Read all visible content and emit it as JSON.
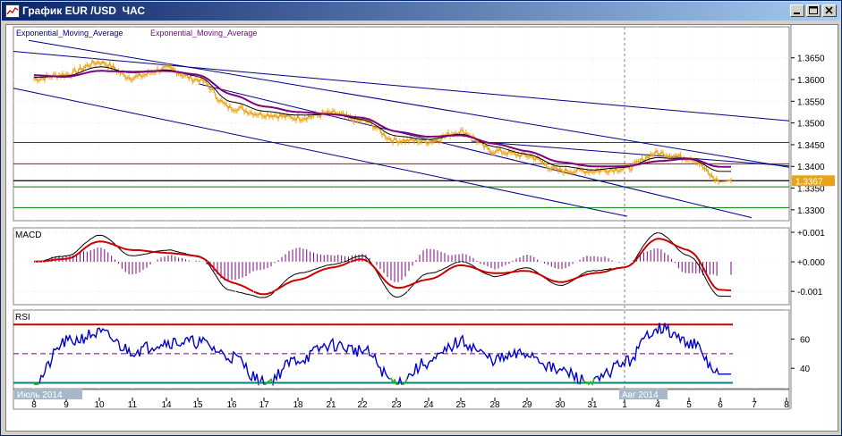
{
  "window": {
    "title": "График EUR /USD  ЧАС",
    "minimize_icon": "minimize-icon",
    "maximize_icon": "maximize-icon",
    "close_icon": "close-icon"
  },
  "colors": {
    "price": "#e8a317",
    "ema_fast": "#000000",
    "ema_slow": "#7f007f",
    "trendline": "#00008b",
    "resistance": "#cc0000",
    "support": "#008000",
    "current_line": "#000000",
    "current_tag": "#e8a317",
    "macd": "#000000",
    "signal": "#cc0000",
    "histogram": "#7f007f",
    "rsi": "#0000cc",
    "rsi_extreme": "#22bb22",
    "rsi_upper_band": "#cc0000",
    "rsi_mid_band": "#7f007f",
    "rsi_lower_band": "#008080"
  },
  "chart_data": [
    {
      "type": "line",
      "panel": "price",
      "legend_text": [
        "Exponential_Moving_Average",
        "Exponential_Moving_Average"
      ],
      "y_ticks": [
        "1.3650",
        "1.3600",
        "1.3550",
        "1.3500",
        "1.3450",
        "1.3400",
        "1.3350",
        "1.3300"
      ],
      "ylim": [
        1.3275,
        1.3705
      ],
      "x": [
        "8",
        "9",
        "10",
        "11",
        "14",
        "15",
        "16",
        "17",
        "18",
        "21",
        "22",
        "23",
        "24",
        "25",
        "28",
        "29",
        "30",
        "31",
        "1",
        "4",
        "5",
        "6"
      ],
      "series": [
        {
          "role": "price",
          "values": [
            1.3602,
            1.3612,
            1.364,
            1.3605,
            1.3625,
            1.36,
            1.3535,
            1.352,
            1.3512,
            1.3522,
            1.3505,
            1.346,
            1.3458,
            1.348,
            1.3435,
            1.3425,
            1.339,
            1.339,
            1.3395,
            1.343,
            1.342,
            1.3367
          ]
        },
        {
          "role": "ema_fast",
          "values": [
            1.3605,
            1.3608,
            1.363,
            1.3615,
            1.3622,
            1.3608,
            1.3548,
            1.3528,
            1.3518,
            1.352,
            1.3508,
            1.347,
            1.3462,
            1.3475,
            1.3445,
            1.3428,
            1.34,
            1.3392,
            1.3398,
            1.342,
            1.3418,
            1.3388
          ]
        },
        {
          "role": "ema_slow",
          "values": [
            1.361,
            1.3606,
            1.362,
            1.3618,
            1.362,
            1.3612,
            1.3565,
            1.3538,
            1.3525,
            1.352,
            1.3512,
            1.348,
            1.3468,
            1.3472,
            1.3452,
            1.3435,
            1.341,
            1.34,
            1.34,
            1.3412,
            1.3418,
            1.3398
          ]
        }
      ],
      "horizontal_levels": [
        {
          "role": "resistance",
          "value": 1.3455
        },
        {
          "role": "resistance",
          "value": 1.3406
        },
        {
          "role": "current",
          "value": 1.3367
        },
        {
          "role": "support",
          "value": 1.3353
        },
        {
          "role": "support",
          "value": 1.3305
        }
      ],
      "current_price_label": "1.3367"
    },
    {
      "type": "bar",
      "panel": "macd",
      "legend_text": [
        "MACD"
      ],
      "y_ticks": [
        "+0.001",
        "+0.000",
        "-0.001"
      ],
      "ylim": [
        -0.00145,
        0.00115
      ],
      "x": [
        "8",
        "9",
        "10",
        "11",
        "14",
        "15",
        "16",
        "17",
        "18",
        "21",
        "22",
        "23",
        "24",
        "25",
        "28",
        "29",
        "30",
        "31",
        "1",
        "4",
        "5",
        "6"
      ],
      "series": [
        {
          "role": "macd",
          "values": [
            0.0,
            0.0002,
            0.0009,
            0.0002,
            0.0004,
            0.0002,
            -0.001,
            -0.0012,
            -0.0004,
            -0.0001,
            0.0002,
            -0.0012,
            -0.0004,
            0.0,
            -0.0005,
            -0.0002,
            -0.0008,
            -0.0003,
            -0.0002,
            0.001,
            0.0002,
            -0.0012
          ]
        },
        {
          "role": "signal",
          "values": [
            0.0,
            0.0001,
            0.0007,
            0.0004,
            0.0003,
            0.0002,
            -0.0007,
            -0.0011,
            -0.0006,
            -0.0002,
            0.0001,
            -0.0009,
            -0.0006,
            -0.0001,
            -0.0004,
            -0.0003,
            -0.0007,
            -0.0004,
            -0.0002,
            0.0008,
            0.0004,
            -0.001
          ]
        }
      ]
    },
    {
      "type": "line",
      "panel": "rsi",
      "legend_text": [
        "RSI"
      ],
      "y_ticks": [
        "60",
        "40"
      ],
      "ylim": [
        26,
        80
      ],
      "bands": [
        70,
        50,
        30
      ],
      "x": [
        "8",
        "9",
        "10",
        "11",
        "14",
        "15",
        "16",
        "17",
        "18",
        "21",
        "22",
        "23",
        "24",
        "25",
        "28",
        "29",
        "30",
        "31",
        "1",
        "4",
        "5",
        "6"
      ],
      "series": [
        {
          "role": "rsi",
          "values": [
            30,
            58,
            64,
            52,
            58,
            58,
            48,
            30,
            46,
            56,
            52,
            30,
            44,
            58,
            46,
            50,
            38,
            30,
            44,
            68,
            58,
            36
          ]
        }
      ]
    }
  ],
  "x_axis": {
    "labels": [
      "8",
      "9",
      "10",
      "11",
      "14",
      "15",
      "16",
      "17",
      "18",
      "21",
      "22",
      "23",
      "24",
      "25",
      "28",
      "29",
      "30",
      "31",
      "1",
      "4",
      "5",
      "6",
      "7",
      "8"
    ],
    "month_labels": [
      "Июль 2014",
      "Авг 2014"
    ]
  }
}
